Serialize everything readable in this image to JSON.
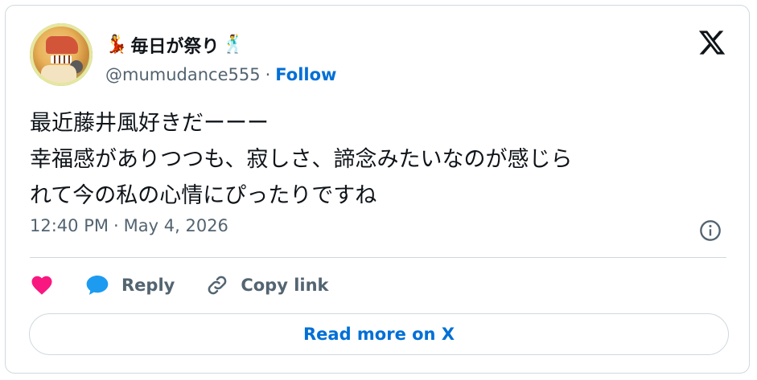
{
  "author": {
    "display_name": "毎日が祭り",
    "leading_emoji": "💃",
    "trailing_emoji": "🕺",
    "username": "@mumudance555",
    "separator": "·",
    "follow_label": "Follow"
  },
  "tweet": {
    "text": "最近藤井風好きだーーー\n幸福感がありつつも、寂しさ、諦念みたいなのが感じら\nれて今の私の心情にぴったりですね",
    "time": "12:40 PM",
    "separator": "·",
    "date": "May 4, 2026"
  },
  "actions": {
    "reply_label": "Reply",
    "copy_link_label": "Copy link"
  },
  "read_more_label": "Read more on X",
  "colors": {
    "link_blue": "#006fd6",
    "like_pink": "#f91880",
    "reply_blue": "#1d9bf0",
    "text_gray": "#536471",
    "border": "#cfd9de"
  },
  "icons": {
    "logo": "x-logo-icon",
    "info": "info-icon",
    "like": "heart-icon",
    "reply": "speech-bubble-icon",
    "copy_link": "link-icon"
  }
}
